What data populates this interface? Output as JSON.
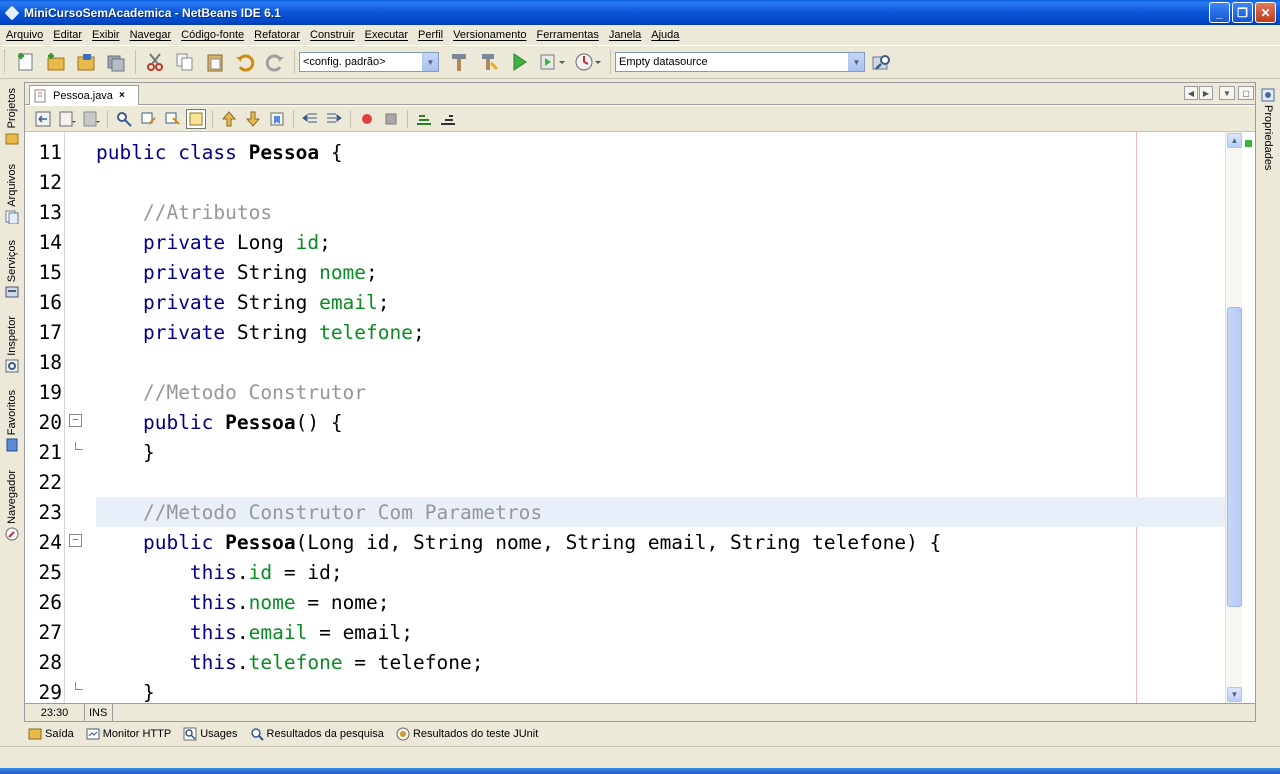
{
  "window": {
    "title": "MiniCursoSemAcademica - NetBeans IDE 6.1",
    "controls": [
      "_",
      "❐",
      "✕"
    ]
  },
  "menu": [
    "Arquivo",
    "Editar",
    "Exibir",
    "Navegar",
    "Código-fonte",
    "Refatorar",
    "Construir",
    "Executar",
    "Perfil",
    "Versionamento",
    "Ferramentas",
    "Janela",
    "Ajuda"
  ],
  "toolbar": {
    "config_combo": "<config. padrão>",
    "datasource_combo": "Empty datasource"
  },
  "left_tabs": [
    "Projetos",
    "Arquivos",
    "Serviços",
    "Inspetor",
    "Favoritos",
    "Navegador"
  ],
  "right_tabs": [
    "Propriedades"
  ],
  "editor": {
    "tab_label": "Pessoa.java",
    "tab_close": "×",
    "cursor_pos": "23:30",
    "insert_mode": "INS"
  },
  "code": {
    "line_numbers": [
      "11",
      "12",
      "13",
      "14",
      "15",
      "16",
      "17",
      "18",
      "19",
      "20",
      "21",
      "22",
      "23",
      "24",
      "25",
      "26",
      "27",
      "28",
      "29"
    ],
    "highlighted_line": "23"
  },
  "output_tabs": [
    "Saída",
    "Monitor HTTP",
    "Usages",
    "Resultados da pesquisa",
    "Resultados do teste JUnit"
  ],
  "colors": {
    "keyword": "#00008b",
    "comment": "#969696",
    "field": "#098c21",
    "current_line": "#e9eff8"
  }
}
